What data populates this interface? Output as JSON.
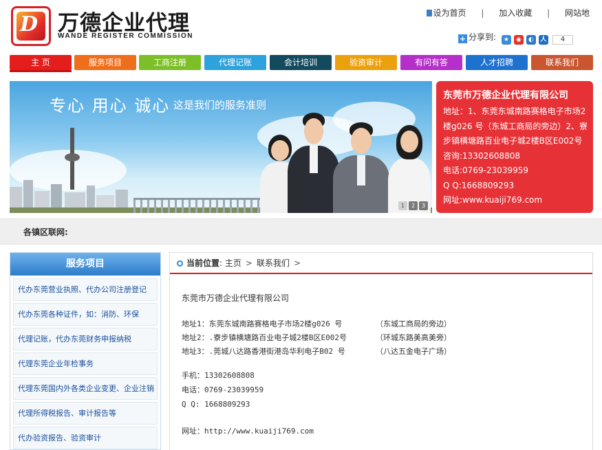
{
  "header": {
    "logo_cn": "万德企业代理",
    "logo_en": "WANDE REGISTER COMMISSION",
    "logo_letter": "D",
    "links": {
      "home": "设为首页",
      "favorite": "加入收藏",
      "sitemap": "网站地"
    },
    "share_label": "分享到:",
    "share_count": "4"
  },
  "nav": [
    {
      "label": "主 页",
      "color": "#e41d1d"
    },
    {
      "label": "服务项目",
      "color": "#ef6e1c"
    },
    {
      "label": "工商注册",
      "color": "#7cbf28"
    },
    {
      "label": "代理记账",
      "color": "#2ea2dd"
    },
    {
      "label": "会计培训",
      "color": "#134a5e"
    },
    {
      "label": "验资审计",
      "color": "#eba10e"
    },
    {
      "label": "有问有答",
      "color": "#b52fcb"
    },
    {
      "label": "人才招聘",
      "color": "#1e72cf"
    },
    {
      "label": "联系我们",
      "color": "#c9562e"
    }
  ],
  "banner": {
    "slogan": "专心 用心 诚心",
    "sub": "这是我们的服务准则",
    "pages": [
      "1",
      "2",
      "3"
    ]
  },
  "contact_box": {
    "title": "东莞市万德企业代理有限公司",
    "address": "地址：1、东莞东城南路赛格电子市场2楼g026 号（东城工商局的旁边）2、寮步镇横塘路百业电子城2楼B区E002号",
    "consult": "咨询:13302608808",
    "phone": "电话:0769-23039959",
    "qq": "Q Q:1668809293",
    "site": "网址:www.kuaiji769.com"
  },
  "region_bar": {
    "label": "各镇区联网:"
  },
  "sidebar": {
    "title": "服务项目",
    "items": [
      "代办东莞营业执照、代办公司注册登记",
      "代办东莞各种证件，如：消防、环保",
      "代理记账，代办东莞财务申报纳税",
      "代理东莞企业年检事务",
      "代理东莞国内外各类企业变更、企业注销",
      "代理所得税报告、审计报告等",
      "代办验资报告、验资审计"
    ]
  },
  "breadcrumb": {
    "label": "当前位置",
    "colon": ":",
    "home": "主页",
    "current": "联系我们",
    "arrow": ">"
  },
  "content": {
    "company": "东莞市万德企业代理有限公司",
    "addresses": [
      {
        "a": "地址1：东莞东城南路赛格电子市场2楼g026 号",
        "b": "（东城工商局的旁边）"
      },
      {
        "a": "地址2：.寮步镇横塘路百业电子城2楼B区E002号",
        "b": "（环城东路美高美旁）"
      },
      {
        "a": "地址3：.莞城八达路香港街港岛华利电子B02 号",
        "b": "（八达五金电子广场）"
      }
    ],
    "mobile": "手机：13302608808",
    "tel": "电话：0769-23039959",
    "qq": "Q Q: 1668809293",
    "site": "网址：http://www.kuaiji769.com"
  }
}
